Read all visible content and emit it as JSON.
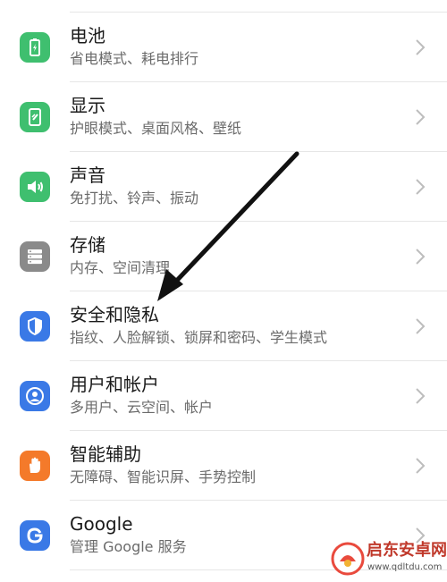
{
  "settings": {
    "items": [
      {
        "id": "battery",
        "title": "电池",
        "subtitle": "省电模式、耗电排行",
        "icon": "battery-icon",
        "color": "#3fbf6f"
      },
      {
        "id": "display",
        "title": "显示",
        "subtitle": "护眼模式、桌面风格、壁纸",
        "icon": "display-icon",
        "color": "#3fbf6f"
      },
      {
        "id": "sound",
        "title": "声音",
        "subtitle": "免打扰、铃声、振动",
        "icon": "speaker-icon",
        "color": "#3fbf6f"
      },
      {
        "id": "storage",
        "title": "存储",
        "subtitle": "内存、空间清理",
        "icon": "storage-icon",
        "color": "#8a8a8a"
      },
      {
        "id": "security",
        "title": "安全和隐私",
        "subtitle": "指纹、人脸解锁、锁屏和密码、学生模式",
        "icon": "shield-icon",
        "color": "#3a79e6"
      },
      {
        "id": "users",
        "title": "用户和帐户",
        "subtitle": "多用户、云空间、帐户",
        "icon": "user-icon",
        "color": "#3a79e6"
      },
      {
        "id": "accessibility",
        "title": "智能辅助",
        "subtitle": "无障碍、智能识屏、手势控制",
        "icon": "hand-icon",
        "color": "#f47a2a"
      },
      {
        "id": "google",
        "title": "Google",
        "subtitle": "管理 Google 服务",
        "icon": "google-g-icon",
        "color": "#3a79e6"
      }
    ]
  },
  "annotation": {
    "icon": "arrow-icon",
    "color": "#111111"
  },
  "watermark": {
    "title": "启东安卓网",
    "url": "www.qdltdu.com",
    "icon": "watermark-logo-icon",
    "color": "#c0392b"
  }
}
